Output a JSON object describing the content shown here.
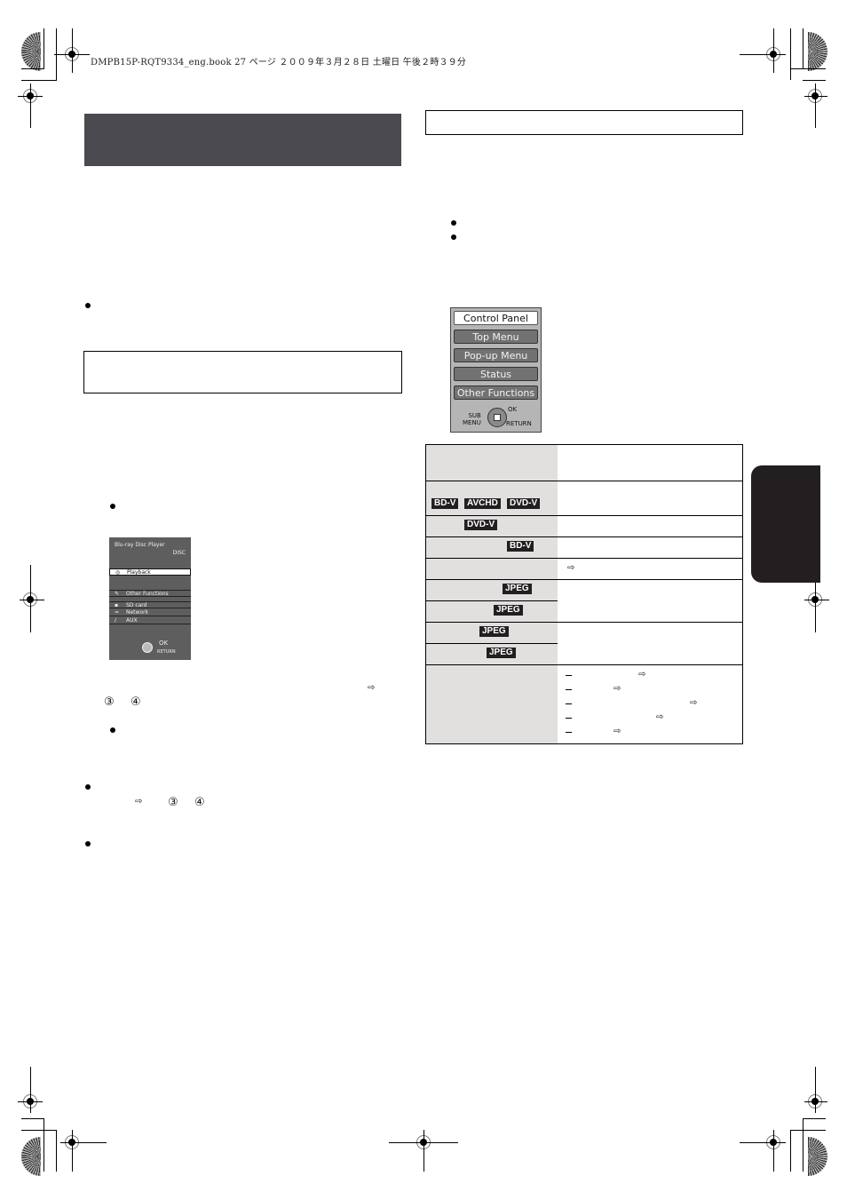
{
  "print_header": {
    "text": "DMPB15P-RQT9334_eng.book  27 ページ  ２００９年３月２８日  土曜日  午後２時３９分"
  },
  "left_column": {
    "section_title": "",
    "note_box": "",
    "home_menu_screen": {
      "title": "Blu-ray Disc Player",
      "source": "DISC",
      "items": [
        {
          "label": "Playback",
          "icon": "disc-icon",
          "selected": true
        },
        {
          "label": "Other Functions",
          "icon": "tools-icon",
          "selected": false
        },
        {
          "label": "SD card",
          "icon": "sd-card-icon",
          "selected": false
        },
        {
          "label": "Network",
          "icon": "network-icon",
          "selected": false
        },
        {
          "label": "AUX",
          "icon": "aux-icon",
          "selected": false
        }
      ],
      "ok_label": "OK",
      "return_label": "RETURN"
    },
    "references": {
      "arrow_glyph": "⇨",
      "circled_3": "③",
      "circled_4": "④"
    }
  },
  "right_column": {
    "section_box": "",
    "popup_menu": {
      "buttons": [
        {
          "label": "Control Panel",
          "active": true
        },
        {
          "label": "Top Menu",
          "active": false
        },
        {
          "label": "Pop-up Menu",
          "active": false
        },
        {
          "label": "Status",
          "active": false
        },
        {
          "label": "Other Functions",
          "active": false
        }
      ],
      "sub_menu_label": "SUB\nMENU",
      "ok_label": "OK",
      "return_label": "RETURN"
    },
    "table": {
      "rows": [
        {
          "badges": [],
          "content": ""
        },
        {
          "badges": [
            "BD-V",
            "AVCHD",
            "DVD-V"
          ],
          "content": ""
        },
        {
          "badges": [
            "DVD-V"
          ],
          "content": ""
        },
        {
          "badges": [
            "BD-V"
          ],
          "content": ""
        },
        {
          "badges": [],
          "content": "⇨"
        },
        {
          "badges": [
            "JPEG"
          ],
          "content": ""
        },
        {
          "badges": [
            "JPEG"
          ],
          "content": ""
        },
        {
          "badges": [
            "JPEG"
          ],
          "content": ""
        },
        {
          "badges": [
            "JPEG"
          ],
          "content": ""
        },
        {
          "badges": [],
          "content": "",
          "sub_items": [
            "—  ⇨",
            "—  ⇨",
            "—  ⇨",
            "—  ⇨",
            "—  ⇨"
          ]
        }
      ],
      "arrow_glyph": "⇨"
    }
  },
  "side_tab": {
    "label": "",
    "color": "#231f20"
  },
  "colors": {
    "title_bar": "#4a4a50",
    "table_label_bg": "#e1e0df",
    "badge_bg": "#231f20",
    "menu_button": "#727272"
  }
}
